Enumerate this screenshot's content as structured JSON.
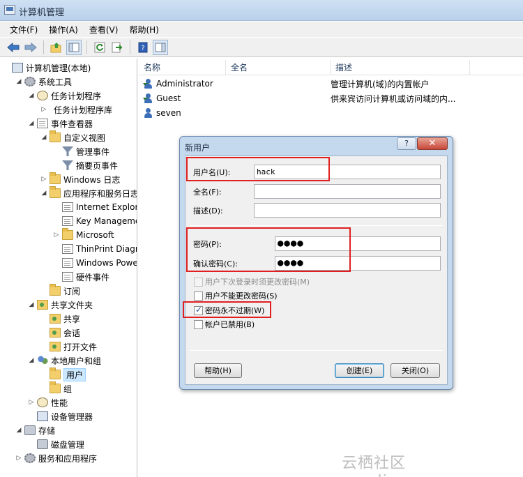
{
  "window": {
    "title": "计算机管理"
  },
  "menu": [
    "文件(F)",
    "操作(A)",
    "查看(V)",
    "帮助(H)"
  ],
  "tree": [
    {
      "label": "计算机管理(本地)",
      "icon": "computer-icon",
      "indent": 0,
      "arrow": ""
    },
    {
      "label": "系统工具",
      "icon": "tools-icon",
      "indent": 1,
      "arrow": "◢"
    },
    {
      "label": "任务计划程序",
      "icon": "clock-icon",
      "indent": 2,
      "arrow": "◢"
    },
    {
      "label": "任务计划程序库",
      "icon": "none",
      "indent": 3,
      "arrow": "▷"
    },
    {
      "label": "事件查看器",
      "icon": "log-icon",
      "indent": 2,
      "arrow": "◢"
    },
    {
      "label": "自定义视图",
      "icon": "folder-icon",
      "indent": 3,
      "arrow": "◢"
    },
    {
      "label": "管理事件",
      "icon": "filter-icon",
      "indent": 4,
      "arrow": ""
    },
    {
      "label": "摘要页事件",
      "icon": "filter-icon",
      "indent": 4,
      "arrow": ""
    },
    {
      "label": "Windows 日志",
      "icon": "folder-icon",
      "indent": 3,
      "arrow": "▷"
    },
    {
      "label": "应用程序和服务日志",
      "icon": "folder-icon",
      "indent": 3,
      "arrow": "◢"
    },
    {
      "label": "Internet Explor",
      "icon": "log-icon",
      "indent": 4,
      "arrow": ""
    },
    {
      "label": "Key Manageme",
      "icon": "log-icon",
      "indent": 4,
      "arrow": ""
    },
    {
      "label": "Microsoft",
      "icon": "folder-icon",
      "indent": 4,
      "arrow": "▷"
    },
    {
      "label": "ThinPrint Diagr",
      "icon": "log-icon",
      "indent": 4,
      "arrow": ""
    },
    {
      "label": "Windows Powe",
      "icon": "log-icon",
      "indent": 4,
      "arrow": ""
    },
    {
      "label": "硬件事件",
      "icon": "log-icon",
      "indent": 4,
      "arrow": ""
    },
    {
      "label": "订阅",
      "icon": "folder-icon",
      "indent": 3,
      "arrow": ""
    },
    {
      "label": "共享文件夹",
      "icon": "share-icon",
      "indent": 2,
      "arrow": "◢"
    },
    {
      "label": "共享",
      "icon": "share-icon",
      "indent": 3,
      "arrow": ""
    },
    {
      "label": "会话",
      "icon": "share-icon",
      "indent": 3,
      "arrow": ""
    },
    {
      "label": "打开文件",
      "icon": "share-icon",
      "indent": 3,
      "arrow": ""
    },
    {
      "label": "本地用户和组",
      "icon": "users-icon",
      "indent": 2,
      "arrow": "◢"
    },
    {
      "label": "用户",
      "icon": "folder-icon",
      "indent": 3,
      "arrow": "",
      "selected": true
    },
    {
      "label": "组",
      "icon": "folder-icon",
      "indent": 3,
      "arrow": ""
    },
    {
      "label": "性能",
      "icon": "gauge-icon",
      "indent": 2,
      "arrow": "▷"
    },
    {
      "label": "设备管理器",
      "icon": "device-icon",
      "indent": 2,
      "arrow": ""
    },
    {
      "label": "存储",
      "icon": "storage-icon",
      "indent": 1,
      "arrow": "◢"
    },
    {
      "label": "磁盘管理",
      "icon": "disk-icon",
      "indent": 2,
      "arrow": ""
    },
    {
      "label": "服务和应用程序",
      "icon": "services-icon",
      "indent": 1,
      "arrow": "▷"
    }
  ],
  "list": {
    "columns": [
      "名称",
      "全名",
      "描述"
    ],
    "rows": [
      {
        "name": "Administrator",
        "fullname": "",
        "desc": "管理计算机(域)的内置帐户",
        "icon": "disabled-user-icon"
      },
      {
        "name": "Guest",
        "fullname": "",
        "desc": "供来宾访问计算机或访问域的内...",
        "icon": "disabled-user-icon"
      },
      {
        "name": "seven",
        "fullname": "",
        "desc": "",
        "icon": "user-icon"
      }
    ]
  },
  "dialog": {
    "title": "新用户",
    "help_glyph": "?",
    "close_glyph": "✕",
    "username_label": "用户名(U):",
    "username_value": "hack",
    "fullname_label": "全名(F):",
    "fullname_value": "",
    "desc_label": "描述(D):",
    "desc_value": "",
    "password_label": "密码(P):",
    "password_value": "●●●●",
    "confirm_label": "确认密码(C):",
    "confirm_value": "●●●●",
    "checkboxes": [
      {
        "label": "用户下次登录时须更改密码(M)",
        "checked": false,
        "disabled": true
      },
      {
        "label": "用户不能更改密码(S)",
        "checked": false,
        "disabled": false
      },
      {
        "label": "密码永不过期(W)",
        "checked": true,
        "disabled": false
      },
      {
        "label": "帐户已禁用(B)",
        "checked": false,
        "disabled": false
      }
    ],
    "help_button": "帮助(H)",
    "create_button": "创建(E)",
    "close_button": "关闭(O)"
  },
  "watermark": "云栖社区 yq.aliyun.com"
}
